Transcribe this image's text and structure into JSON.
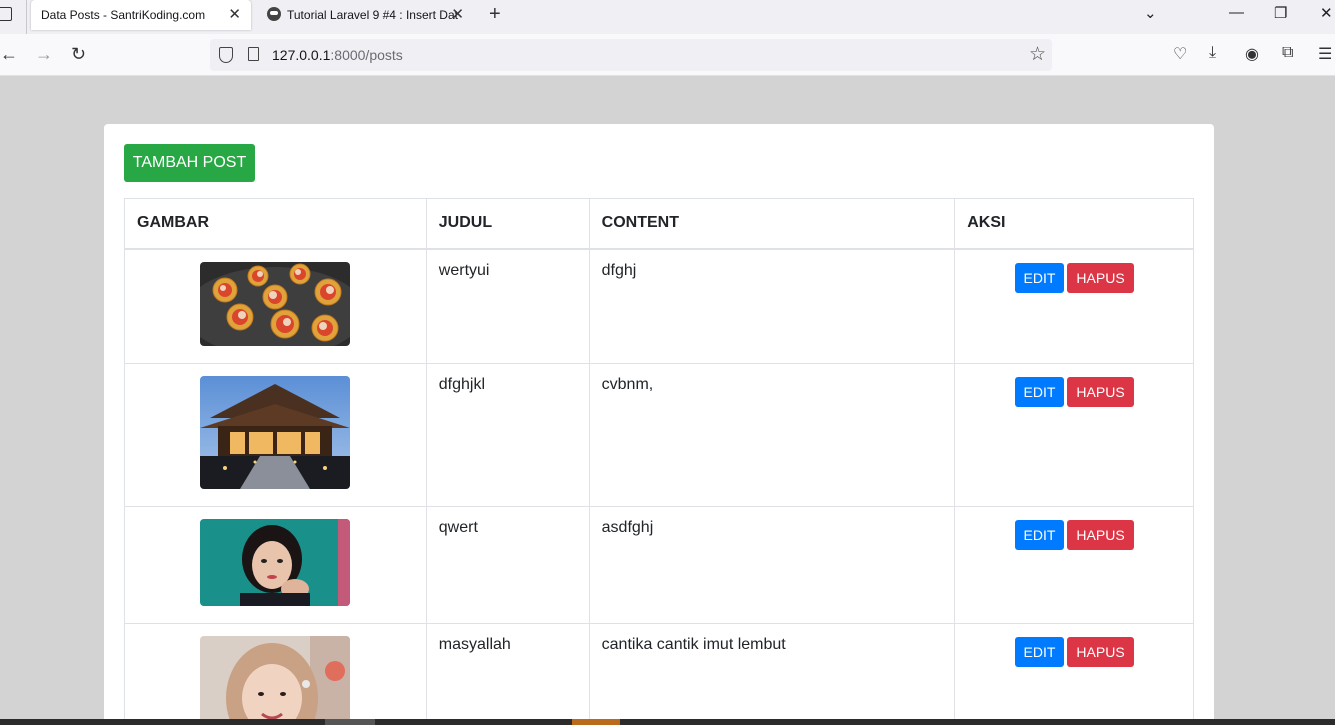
{
  "browser": {
    "tabs": [
      {
        "title": "Data Posts - SantriKoding.com",
        "active": true
      },
      {
        "title": "Tutorial Laravel 9 #4 : Insert Dat",
        "active": false
      }
    ],
    "url_host": "127.0.0.1",
    "url_rest": ":8000/posts"
  },
  "page": {
    "add_button_label": "TAMBAH POST",
    "headers": {
      "gambar": "GAMBAR",
      "judul": "JUDUL",
      "content": "CONTENT",
      "aksi": "AKSI"
    },
    "rows": [
      {
        "judul": "wertyui",
        "content": "dfghj",
        "image": "pizza-image",
        "edit": "EDIT",
        "hapus": "HAPUS"
      },
      {
        "judul": "dfghjkl",
        "content": "cvbnm,",
        "image": "pavilion-image",
        "edit": "EDIT",
        "hapus": "HAPUS"
      },
      {
        "judul": "qwert",
        "content": "asdfghj",
        "image": "girl-selfie-image",
        "edit": "EDIT",
        "hapus": "HAPUS"
      },
      {
        "judul": "masyallah",
        "content": "cantika cantik imut lembut",
        "image": "hijab-girl-image",
        "edit": "EDIT",
        "hapus": "HAPUS"
      }
    ]
  },
  "colors": {
    "add": "#28a745",
    "edit": "#007bff",
    "hapus": "#dc3545"
  }
}
